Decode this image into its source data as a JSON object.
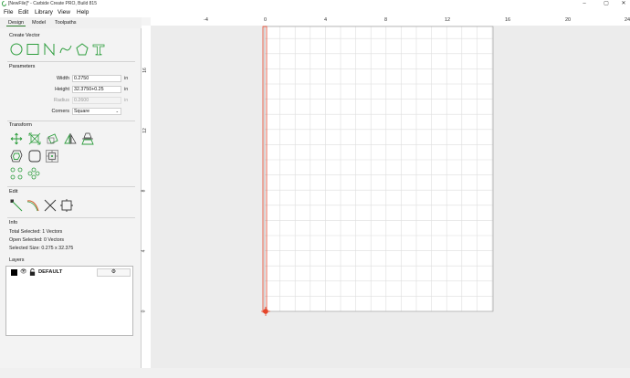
{
  "window": {
    "title": "[NewFile]* - Carbide Create PRO, Build 815",
    "minimize": "–",
    "maximize": "▢",
    "close": "✕"
  },
  "menu": {
    "file": "File",
    "edit": "Edit",
    "library": "Library",
    "view": "View",
    "help": "Help"
  },
  "tabs": {
    "design": "Design",
    "model": "Model",
    "toolpaths": "Toolpaths",
    "active": "Design"
  },
  "sections": {
    "create_vector": "Create Vector",
    "parameters": "Parameters",
    "transform": "Transform",
    "edit": "Edit",
    "info": "Info",
    "layers": "Layers"
  },
  "create_vector_icons": [
    "circle-icon",
    "rectangle-icon",
    "polyline-icon",
    "curve-icon",
    "polygon-icon",
    "text-icon"
  ],
  "parameters": {
    "width_label": "Width",
    "width_value": "0.2750",
    "width_unit": "in",
    "height_label": "Height",
    "height_value": "32.3750+0.25",
    "height_unit": "in",
    "radius_label": "Radius",
    "radius_value": "0.2600",
    "radius_unit": "in",
    "corners_label": "Corners",
    "corners_value": "Square"
  },
  "transform_icons": [
    "move-icon",
    "scale-icon",
    "rotate-icon",
    "mirror-icon",
    "flip-icon",
    "offset-icon",
    "fillet-icon",
    "align-icon",
    "circular-array-icon",
    "rectangular-array-icon"
  ],
  "edit_icons": [
    "node-edit-icon",
    "trim-icon",
    "cut-icon",
    "boundary-icon"
  ],
  "info": {
    "total_selected": "Total Selected:   1 Vectors",
    "open_selected": "Open Selected:   0 Vectors",
    "selected_size": "Selected Size:    0.275 x 32.375"
  },
  "layers": [
    {
      "name": "DEFAULT",
      "color": "#000000",
      "visible": true,
      "locked": false
    }
  ],
  "ruler": {
    "top_ticks": [
      "-4",
      "0",
      "4",
      "8",
      "12",
      "16",
      "20",
      "24"
    ],
    "left_ticks": [
      "16",
      "12",
      "8",
      "4",
      "0"
    ]
  },
  "colors": {
    "accent_icon": "#2e9e3e",
    "selection_line": "#e5452a",
    "grid_line": "#dedede",
    "stock_bg": "#ffffff"
  }
}
